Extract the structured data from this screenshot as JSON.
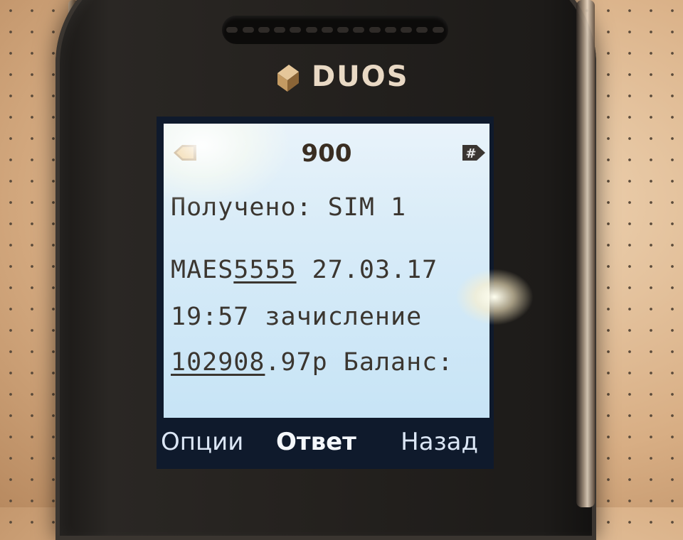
{
  "brand": {
    "name": "DUOS"
  },
  "message": {
    "title": "900",
    "received": "Получено: SIM 1",
    "line1_a": "MAES",
    "line1_b": "5555",
    "line1_c": " 27.03.17",
    "line2": "19:57 зачисление",
    "line3_a": "102908",
    "line3_b": ".97р Баланс:"
  },
  "softkeys": {
    "left": "Опции",
    "center": "Ответ",
    "right": "Назад"
  },
  "colors": {
    "display": "#d9ecf8",
    "text": "#3b3630",
    "softkey_bar": "#0f1a2c"
  }
}
